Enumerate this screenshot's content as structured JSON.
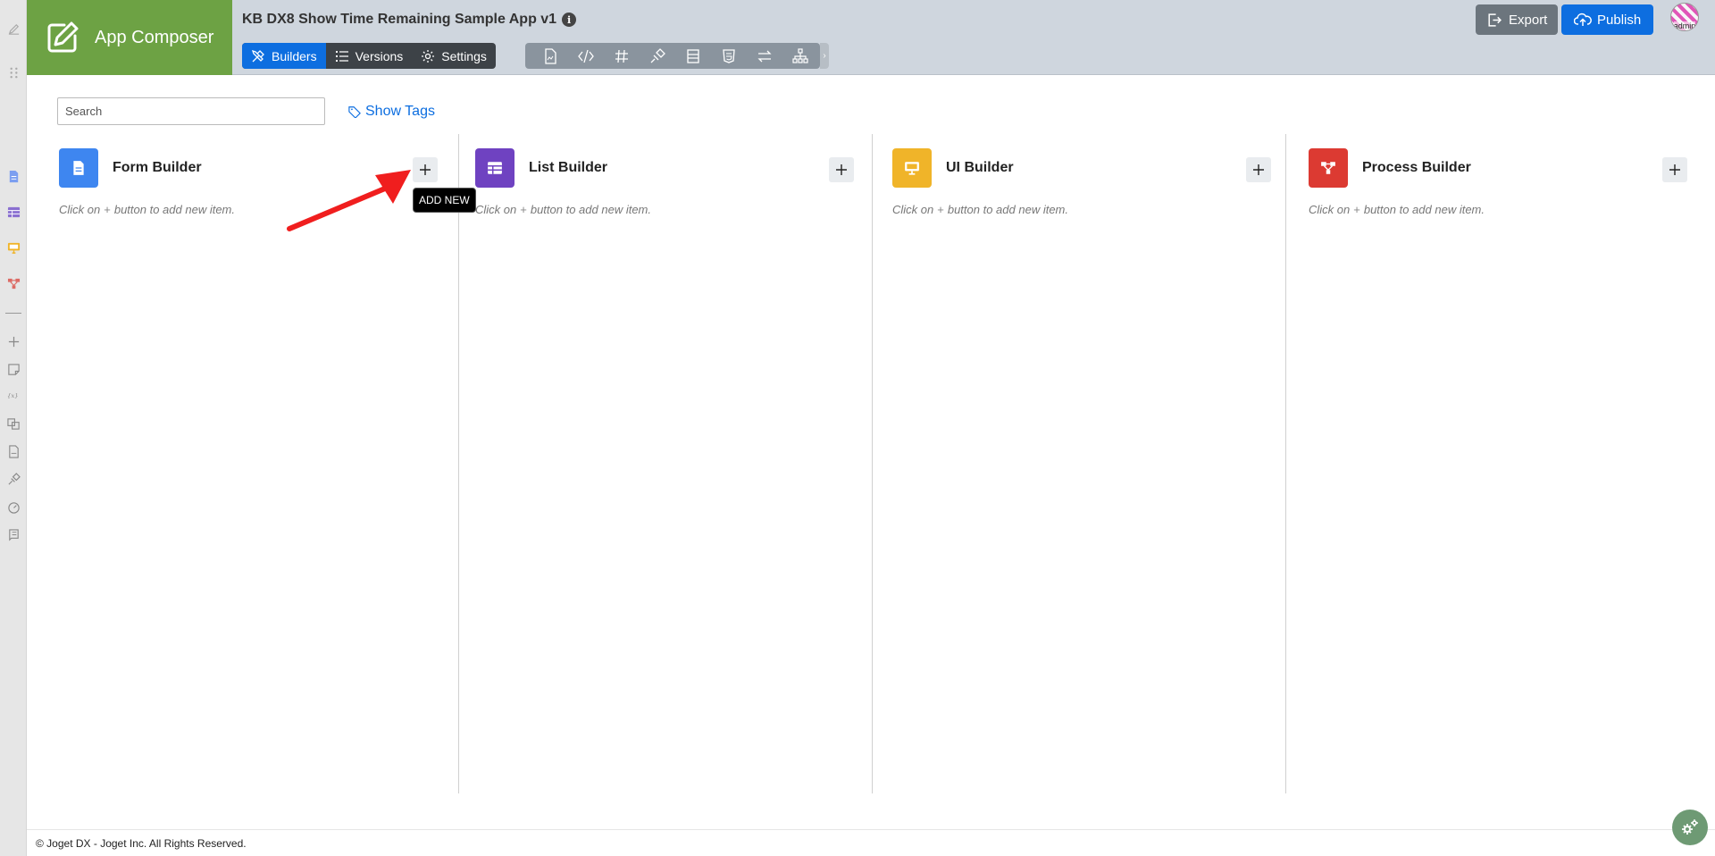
{
  "header": {
    "brand": "App Composer",
    "app_title": "KB DX8 Show Time Remaining Sample App v1",
    "tabs": [
      {
        "label": "Builders",
        "active": true
      },
      {
        "label": "Versions",
        "active": false
      },
      {
        "label": "Settings",
        "active": false
      }
    ],
    "export_label": "Export",
    "publish_label": "Publish",
    "avatar_text": "admin"
  },
  "toolbar_icons": [
    "pdf-file-icon",
    "code-icon",
    "hash-icon",
    "plugin-icon",
    "list-table-icon",
    "html5-icon",
    "swap-arrows-icon",
    "sitemap-icon"
  ],
  "search": {
    "placeholder": "Search"
  },
  "show_tags": "Show Tags",
  "columns": [
    {
      "title": "Form Builder",
      "color": "#3e86f0",
      "hint_before": "Click on",
      "hint_after": "button to add new item."
    },
    {
      "title": "List Builder",
      "color": "#6f42c1",
      "hint_before": "Click on",
      "hint_after": "button to add new item."
    },
    {
      "title": "UI Builder",
      "color": "#f0b429",
      "hint_before": "Click on",
      "hint_after": "button to add new item."
    },
    {
      "title": "Process Builder",
      "color": "#dc3a32",
      "hint_before": "Click on",
      "hint_after": "button to add new item."
    }
  ],
  "tooltip": "ADD NEW",
  "hint_plus": "+",
  "footer": "© Joget DX - Joget Inc. All Rights Reserved.",
  "colors": {
    "brand": "#6da244",
    "primary": "#0d6ee0",
    "header_bg": "#cfd6de",
    "arrow": "#f01e1e"
  }
}
